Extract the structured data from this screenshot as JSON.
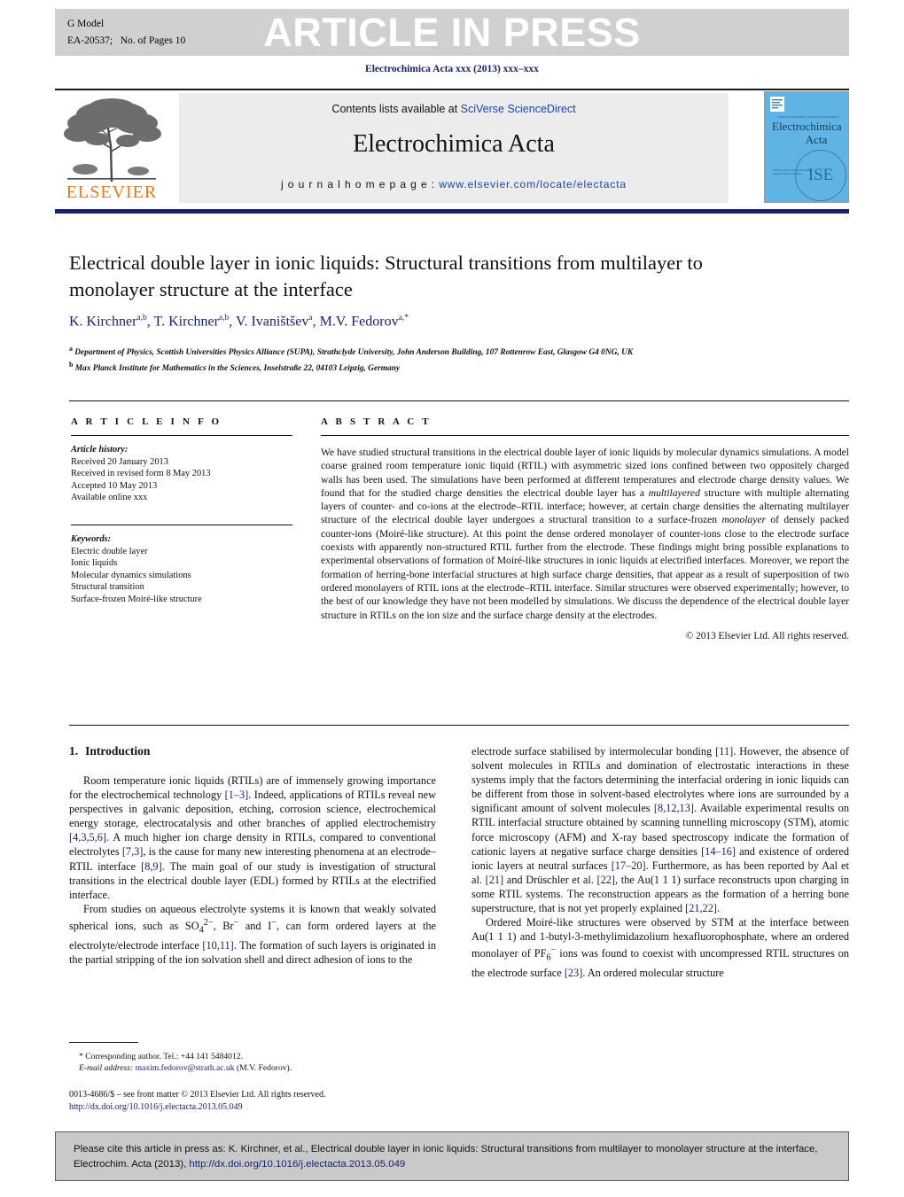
{
  "banner": {
    "g_model": "G Model",
    "article_id": "EA-20537;   No. of Pages 10",
    "aip": "ARTICLE IN PRESS"
  },
  "running_head": "Electrochimica Acta xxx (2013) xxx–xxx",
  "masthead": {
    "contents_prefix": "Contents lists available at ",
    "sciencedirect": "SciVerse ScienceDirect",
    "journal_name": "Electrochimica Acta",
    "homepage_prefix": "j o u r n a l  h o m e p a g e :  ",
    "homepage_url": "www.elsevier.com/locate/electacta",
    "elsevier_wordmark": "ELSEVIER",
    "cover": {
      "top_line": "journal of electrochemistry and interfacial electrochemistry",
      "title_line1": "Electrochimica",
      "title_line2": "Acta",
      "blurb": "Official journal of the International Society of Electrochemistry",
      "society_mark": "ISE"
    }
  },
  "article": {
    "title": "Electrical double layer in ionic liquids: Structural transitions from multilayer to monolayer structure at the interface",
    "authors_html": "K. Kirchner<sup>a,b</sup>, T. Kirchner<sup>a,b</sup>, V. Ivaništšev<sup>a</sup>, M.V. Fedorov<sup>a,</sup><sup>*</sup>",
    "affiliation_a": "Department of Physics, Scottish Universities Physics Alliance (SUPA), Strathclyde University, John Anderson Building, 107 Rottenrow East, Glasgow G4 0NG, UK",
    "affiliation_b": "Max Planck Institute for Mathematics in the Sciences, Inselstraße 22, 04103 Leipzig, Germany"
  },
  "article_info": {
    "heading": "A R T I C L E   I N F O",
    "history_label": "Article history:",
    "history": [
      "Received 20 January 2013",
      "Received in revised form 8 May 2013",
      "Accepted 10 May 2013",
      "Available online xxx"
    ],
    "keywords_label": "Keywords:",
    "keywords": [
      "Electric double layer",
      "Ionic liquids",
      "Molecular dynamics simulations",
      "Structural transition",
      "Surface-frozen Moiré-like structure"
    ]
  },
  "abstract": {
    "heading": "A B S T R A C T",
    "text_html": "We have studied structural transitions in the electrical double layer of ionic liquids by molecular dynamics simulations. A model coarse grained room temperature ionic liquid (RTIL) with asymmetric sized ions confined between two oppositely charged walls has been used. The simulations have been performed at different temperatures and electrode charge density values. We found that for the studied charge densities the electrical double layer has a <em>multilayered</em> structure with multiple alternating layers of counter- and co-ions at the electrode–RTIL interface; however, at certain charge densities the alternating multilayer structure of the electrical double layer undergoes a structural transition to a surface-frozen <em>monolayer</em> of densely packed counter-ions (Moiré-like structure). At this point the dense ordered monolayer of counter-ions close to the electrode surface coexists with apparently non-structured RTIL further from the electrode. These findings might bring possible explanations to experimental observations of formation of Moiré-like structures in ionic liquids at electrified interfaces. Moreover, we report the formation of herring-bone interfacial structures at high surface charge densities, that appear as a result of superposition of two ordered monolayers of RTIL ions at the electrode–RTIL interface. Similar structures were observed experimentally; however, to the best of our knowledge they have not been modelled by simulations. We discuss the dependence of the electrical double layer structure in RTILs on the ion size and the surface charge density at the electrodes.",
    "copyright": "© 2013 Elsevier Ltd. All rights reserved."
  },
  "body": {
    "section_number": "1.",
    "section_title": "Introduction",
    "left_paragraphs_html": [
      "Room temperature ionic liquids (RTILs) are of immensely growing importance for the electrochemical technology <span class=\"ref\">[1–3]</span>. Indeed, applications of RTILs reveal new perspectives in galvanic deposition, etching, corrosion science, electrochemical energy storage, electrocatalysis and other branches of applied electrochemistry <span class=\"ref\">[4,3,5,6]</span>. A much higher ion charge density in RTILs, compared to conventional electrolytes <span class=\"ref\">[7,3]</span>, is the cause for many new interesting phenomena at an electrode–RTIL interface <span class=\"ref\">[8,9]</span>. The main goal of our study is investigation of structural transitions in the electrical double layer (EDL) formed by RTILs at the electrified interface.",
      "From studies on aqueous electrolyte systems it is known that weakly solvated spherical ions, such as SO<sub>4</sub><sup>2−</sup>, Br<sup>−</sup> and I<sup>−</sup>, can form ordered layers at the electrolyte/electrode interface <span class=\"ref\">[10,11]</span>. The formation of such layers is originated in the partial stripping of the ion solvation shell and direct adhesion of ions to the"
    ],
    "right_paragraphs_html": [
      "electrode surface stabilised by intermolecular bonding <span class=\"ref\">[11]</span>. However, the absence of solvent molecules in RTILs and domination of electrostatic interactions in these systems imply that the factors determining the interfacial ordering in ionic liquids can be different from those in solvent-based electrolytes where ions are surrounded by a significant amount of solvent molecules <span class=\"ref\">[8,12,13]</span>. Available experimental results on RTIL interfacial structure obtained by scanning tunnelling microscopy (STM), atomic force microscopy (AFM) and X-ray based spectroscopy indicate the formation of cationic layers at negative surface charge densities <span class=\"ref\">[14–16]</span> and existence of ordered ionic layers at neutral surfaces <span class=\"ref\">[17–20]</span>. Furthermore, as has been reported by Aal et al. <span class=\"ref\">[21]</span> and Drüschler et al. <span class=\"ref\">[22]</span>, the Au(1 1 1) surface reconstructs upon charging in some RTIL systems. The reconstruction appears as the formation of a herring bone superstructure, that is not yet properly explained <span class=\"ref\">[21,22]</span>.",
      "Ordered Moiré-like structures were observed by STM at the interface between Au(1 1 1) and 1-butyl-3-methylimidazolium hexafluorophosphate, where an ordered monolayer of PF<sub>6</sub><sup>−</sup> ions was found to coexist with uncompressed RTIL structures on the electrode surface <span class=\"ref\">[23]</span>. An ordered molecular structure"
    ]
  },
  "footnote": {
    "corresponding": "* Corresponding author. Tel.: +44 141 5484012.",
    "email_label": "E-mail address:",
    "email": "maxim.fedorov@strath.ac.uk",
    "email_suffix": " (M.V. Fedorov)."
  },
  "issn": {
    "line1": "0013-4686/$ – see front matter © 2013 Elsevier Ltd. All rights reserved.",
    "doi": "http://dx.doi.org/10.1016/j.electacta.2013.05.049"
  },
  "cite_footer": {
    "text": "Please cite this article in press as: K. Kirchner, et al., Electrical double layer in ionic liquids: Structural transitions from multilayer to monolayer structure at the interface, Electrochim. Acta (2013), ",
    "doi": "http://dx.doi.org/10.1016/j.electacta.2013.05.049"
  },
  "colors": {
    "link_blue": "#1a44b8",
    "ref_navy": "#19216c",
    "elsevier_orange": "#e87722",
    "banner_gray": "#d0d0d0",
    "cover_blue": "#5fb4e5"
  }
}
